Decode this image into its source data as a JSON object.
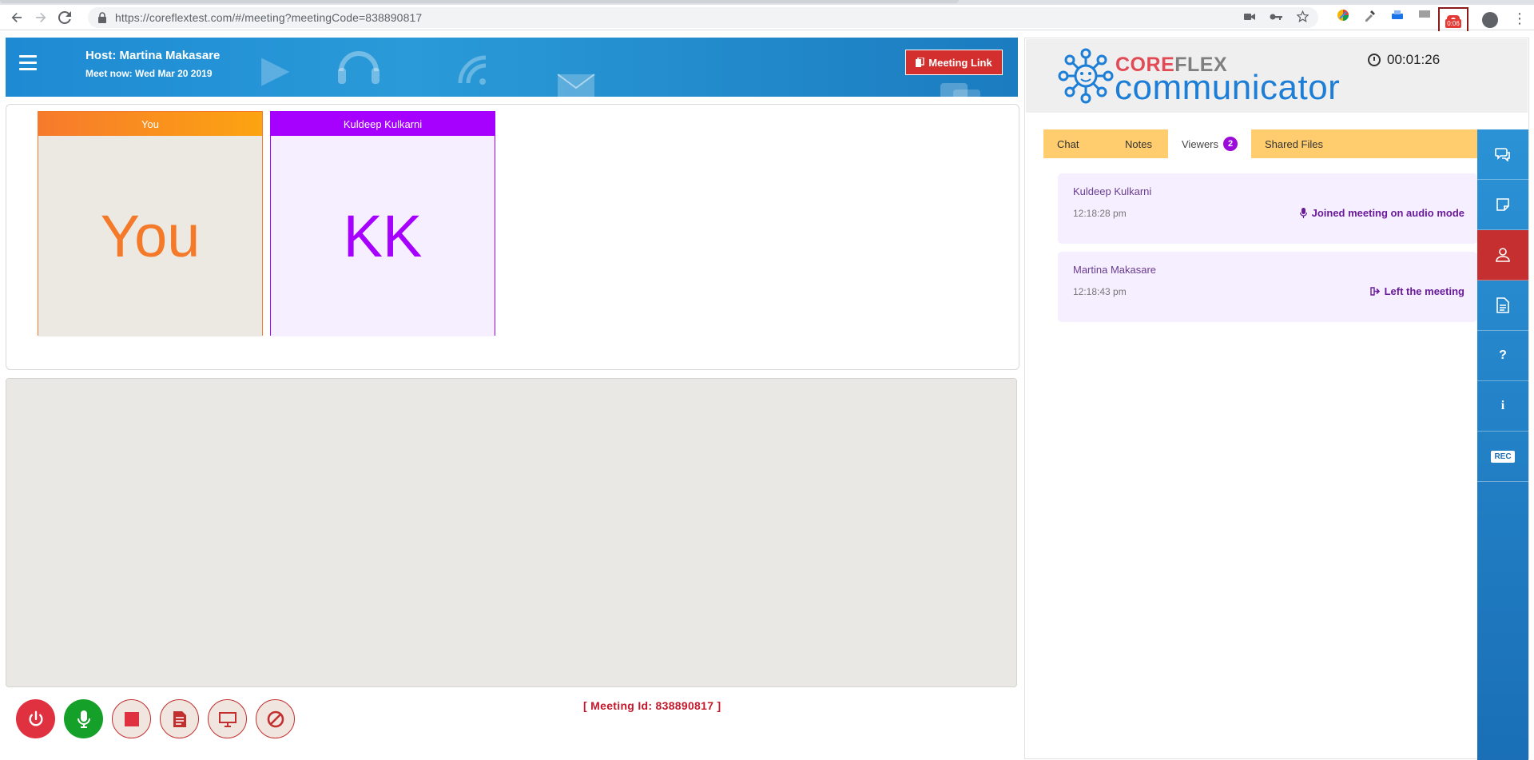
{
  "browser": {
    "url": "https://coreflextest.com/#/meeting?meetingCode=838890817",
    "extension_badge": "0:06"
  },
  "header": {
    "host": "Host: Martina Makasare",
    "subtitle": "Meet now: Wed Mar 20 2019",
    "meeting_link_label": "Meeting Link"
  },
  "participants": [
    {
      "header": "You",
      "initials": "You"
    },
    {
      "header": "Kuldeep Kulkarni",
      "initials": "KK"
    }
  ],
  "meeting_id_text": "[ Meeting Id: 838890817 ]",
  "brand": {
    "core_a": "CO",
    "core_o": "R",
    "core_b": "E",
    "flex": "FLEX",
    "communicator": "communicator"
  },
  "timer": "00:01:26",
  "tabs": {
    "chat": "Chat",
    "notes": "Notes",
    "viewers": "Viewers",
    "viewers_count": "2",
    "shared_files": "Shared Files"
  },
  "viewers": [
    {
      "name": "Kuldeep Kulkarni",
      "time": "12:18:28 pm",
      "status": "Joined meeting on audio mode"
    },
    {
      "name": "Martina Makasare",
      "time": "12:18:43 pm",
      "status": "Left the meeting"
    }
  ],
  "rail": {
    "rec_label": "REC"
  },
  "colors": {
    "accent_blue": "#1c7ed6",
    "danger_red": "#e03140",
    "participant_you": "#f47a2a",
    "participant_kk": "#a600ff",
    "tabs_bg": "#ffcd6d"
  }
}
